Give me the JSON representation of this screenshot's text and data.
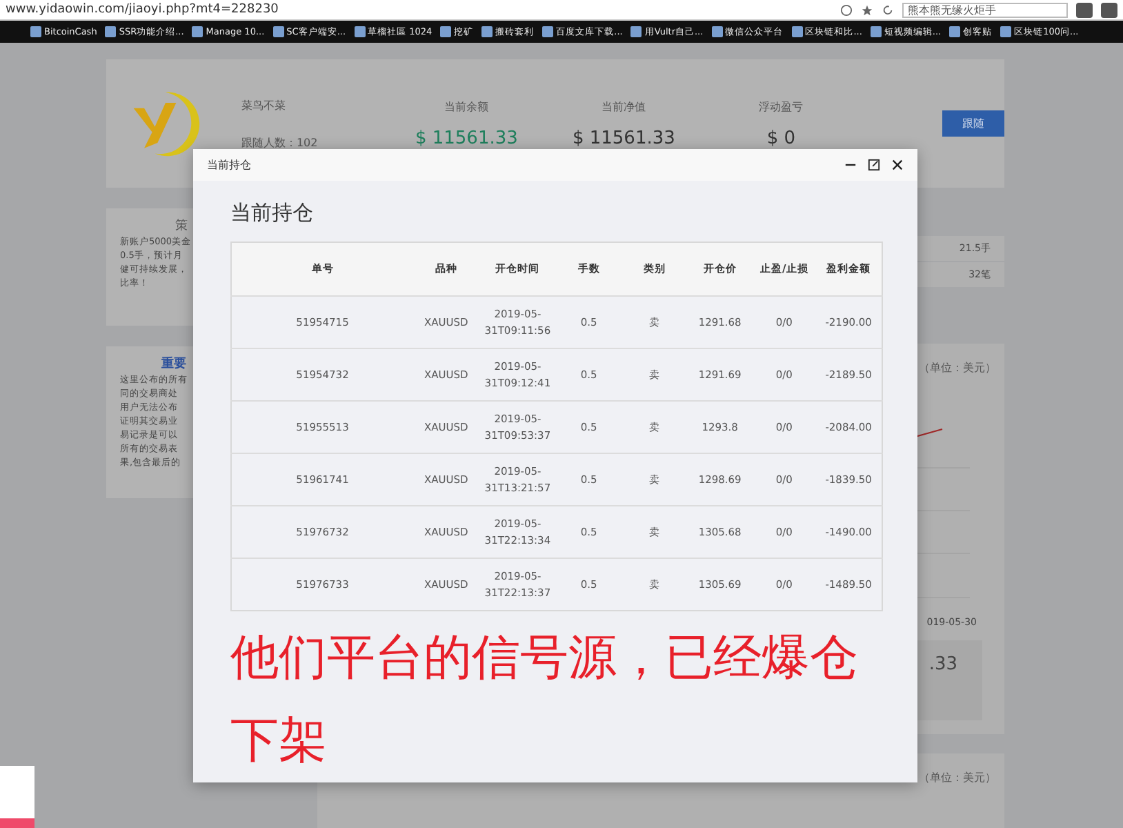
{
  "browser": {
    "url": "www.yidaowin.com/jiaoyi.php?mt4=228230",
    "search": "熊本熊无缘火炬手"
  },
  "bookmarks": [
    "BitcoinCash",
    "SSR功能介绍...",
    "Manage 10...",
    "SC客户端安...",
    "草榴社區 1024",
    "挖矿",
    "搬砖套利",
    "百度文库下载...",
    "用Vultr自己...",
    "微信公众平台",
    "区块链和比...",
    "短视频编辑...",
    "创客贴",
    "区块链100问..."
  ],
  "profile": {
    "name": "菜鸟不菜",
    "followers": "跟随人数：102",
    "stats": [
      {
        "label": "当前余额",
        "value": "$ 11561.33",
        "kind": "positive"
      },
      {
        "label": "当前净值",
        "value": "$ 11561.33",
        "kind": "plain"
      },
      {
        "label": "浮动盈亏",
        "value": "$ 0",
        "kind": "plain"
      }
    ],
    "follow_button": "跟随"
  },
  "strategy_panel": {
    "title": "策",
    "lines": [
      "新账户5000美金",
      "0.5手，预计月",
      "健可持续发展，",
      "比率！"
    ]
  },
  "notice_panel": {
    "title": "重要",
    "lines": [
      "这里公布的所有",
      "同的交易商处",
      "用户无法公布",
      "证明其交易业",
      "易记录是可以",
      "所有的交易表",
      "果,包含最后的"
    ]
  },
  "summary_rows": [
    "21.5手",
    "32笔"
  ],
  "chart_panel": {
    "unit": "（单位：美元）",
    "x_label": "019-05-30",
    "figure": ".33"
  },
  "lower_panel": {
    "unit": "（单位：美元）"
  },
  "modal": {
    "title": "当前持仓",
    "heading": "当前持仓",
    "columns": [
      "单号",
      "品种",
      "开仓时间",
      "手数",
      "类别",
      "开仓价",
      "止盈/止损",
      "盈利金额"
    ],
    "rows": [
      [
        "51954715",
        "XAUUSD",
        "2019-05-31T09:11:56",
        "0.5",
        "卖",
        "1291.68",
        "0/0",
        "-2190.00"
      ],
      [
        "51954732",
        "XAUUSD",
        "2019-05-31T09:12:41",
        "0.5",
        "卖",
        "1291.69",
        "0/0",
        "-2189.50"
      ],
      [
        "51955513",
        "XAUUSD",
        "2019-05-31T09:53:37",
        "0.5",
        "卖",
        "1293.8",
        "0/0",
        "-2084.00"
      ],
      [
        "51961741",
        "XAUUSD",
        "2019-05-31T13:21:57",
        "0.5",
        "卖",
        "1298.69",
        "0/0",
        "-1839.50"
      ],
      [
        "51976732",
        "XAUUSD",
        "2019-05-31T22:13:34",
        "0.5",
        "卖",
        "1305.68",
        "0/0",
        "-1490.00"
      ],
      [
        "51976733",
        "XAUUSD",
        "2019-05-31T22:13:37",
        "0.5",
        "卖",
        "1305.69",
        "0/0",
        "-1489.50"
      ]
    ],
    "annotation": "他们平台的信号源，已经爆仓下架"
  }
}
